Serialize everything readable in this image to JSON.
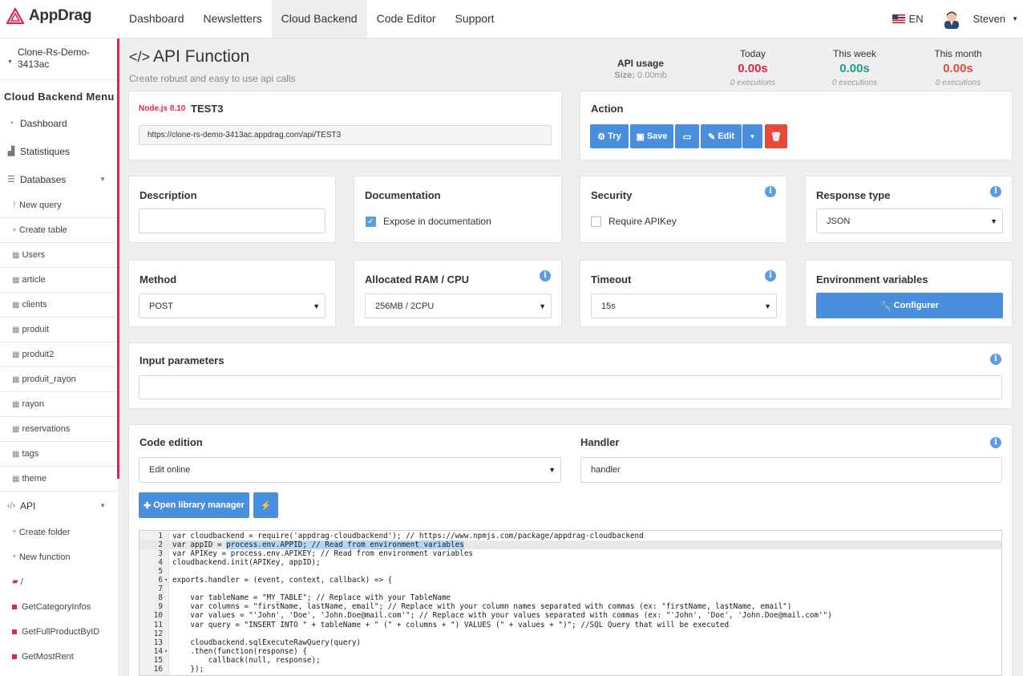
{
  "app": {
    "name": "AppDrag",
    "brand_color": "#e0254b",
    "accent_color": "#4a8fde"
  },
  "nav": {
    "items": [
      "Dashboard",
      "Newsletters",
      "Cloud Backend",
      "Code Editor",
      "Support"
    ],
    "active": "Cloud Backend"
  },
  "topright": {
    "lang": "EN",
    "user": "Steven"
  },
  "sidebar": {
    "project_line1": "Clone-Rs-Demo-",
    "project_line2": "3413ac",
    "menu_title": "Cloud Backend Menu",
    "dashboard": "Dashboard",
    "stats": "Statistiques",
    "databases": "Databases",
    "new_query": "New query",
    "create_table": "Create table",
    "tables": [
      "Users",
      "article",
      "clients",
      "produit",
      "produit2",
      "produit_rayon",
      "rayon",
      "reservations",
      "tags",
      "theme"
    ],
    "api": "API",
    "create_folder": "Create folder",
    "new_function": "New function",
    "root_folder": "/",
    "functions": [
      "GetCategoryInfos",
      "GetFullProductByID",
      "GetMostRent"
    ]
  },
  "header": {
    "title": "API Function",
    "subtitle": "Create robust and easy to use api calls",
    "usage_label": "API usage",
    "size_label": "Size:",
    "size_value": "0.00mb",
    "today": {
      "label": "Today",
      "value": "0.00s",
      "exec": "0 executions",
      "color": "#e0254b"
    },
    "week": {
      "label": "This week",
      "value": "0.00s",
      "exec": "0 executions",
      "color": "#1f9c8a"
    },
    "month": {
      "label": "This month",
      "value": "0.00s",
      "exec": "0 executions",
      "color": "#e7493b"
    }
  },
  "function": {
    "runtime": "Node.js 8.10",
    "name": "TEST3",
    "url": "https://clone-rs-demo-3413ac.appdrag.com/api/TEST3"
  },
  "action": {
    "title": "Action",
    "try": "Try",
    "save": "Save",
    "edit": "Edit"
  },
  "description": {
    "title": "Description",
    "value": ""
  },
  "documentation": {
    "title": "Documentation",
    "checkbox": "Expose in documentation",
    "checked": true
  },
  "security": {
    "title": "Security",
    "checkbox": "Require APIKey",
    "checked": false
  },
  "response": {
    "title": "Response type",
    "value": "JSON"
  },
  "method": {
    "title": "Method",
    "value": "POST"
  },
  "ram": {
    "title": "Allocated RAM / CPU",
    "value": "256MB / 2CPU"
  },
  "timeout": {
    "title": "Timeout",
    "value": "15s"
  },
  "env": {
    "title": "Environment variables",
    "button": "Configurer"
  },
  "params": {
    "title": "Input parameters",
    "value": ""
  },
  "code_edition": {
    "title": "Code edition",
    "value": "Edit online",
    "library_button": "Open library manager"
  },
  "handler": {
    "title": "Handler",
    "value": "handler"
  },
  "editor": {
    "lines": [
      "var cloudbackend = require('appdrag-cloudbackend'); // https://www.npmjs.com/package/appdrag-cloudbackend",
      "var appID = process.env.APPID; // Read from environment variables",
      "var APIKey = process.env.APIKEY; // Read from environment variables",
      "cloudbackend.init(APIKey, appID);",
      "",
      "exports.handler = (event, context, callback) => {",
      "",
      "    var tableName = \"MY_TABLE\"; // Replace with your TableName",
      "    var columns = \"firstName, lastName, email\"; // Replace with your column names separated with commas (ex: \"firstName, lastName, email\")",
      "    var values = \"'John', 'Doe', 'John.Doe@mail.com'\"; // Replace with your values separated with commas (ex: \"'John', 'Doe', 'John.Doe@mail.com'\")",
      "    var query = \"INSERT INTO \" + tableName + \" (\" + columns + \") VALUES (\" + values + \")\"; //SQL Query that will be executed",
      "",
      "    cloudbackend.sqlExecuteRawQuery(query)",
      "    .then(function(response) {",
      "        callback(null, response);",
      "    });"
    ],
    "active_line": 2,
    "highlight": "process.env.APPID; // Read from environment variables"
  }
}
